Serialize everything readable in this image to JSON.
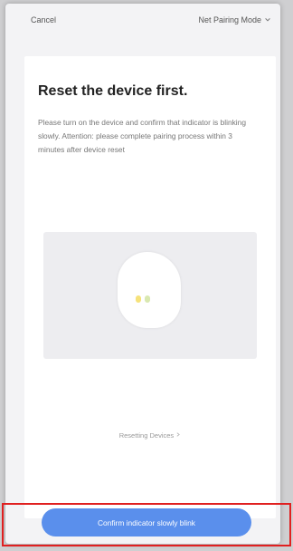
{
  "header": {
    "cancel": "Cancel",
    "mode": "Net Pairing Mode"
  },
  "content": {
    "title": "Reset the device first.",
    "description": "Please turn on the device and confirm that indicator is blinking slowly. Attention: please complete pairing process within 3 minutes after device reset",
    "reset_link": "Resetting Devices"
  },
  "actions": {
    "confirm": "Confirm indicator slowly blink"
  },
  "colors": {
    "primary": "#5a8fec",
    "highlight": "#e02020"
  },
  "icons": {
    "mode_chevron": "chevron-down-icon",
    "link_chevron": "chevron-right-icon"
  }
}
